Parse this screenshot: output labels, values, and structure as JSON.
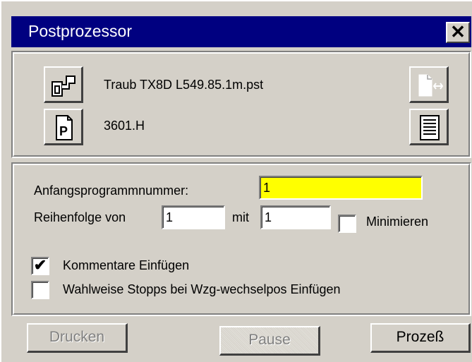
{
  "window": {
    "title": "Postprozessor",
    "close_label": "✕"
  },
  "files": {
    "machine_file": "Traub TX8D L549.85.1m.pst",
    "program_file": "3601.H"
  },
  "icons": {
    "machine": "machine-icon",
    "program": "program-p-icon",
    "file_transfer": "file-transfer-icon",
    "document": "document-list-icon"
  },
  "settings": {
    "start_label": "Anfangsprogrammnummer:",
    "start_value": "1",
    "order_label": "Reihenfolge von",
    "order_from": "1",
    "order_with_label": "mit",
    "order_with": "1",
    "minimize_label": "Minimieren",
    "minimize_checked": false,
    "comments_label": "Kommentare Einfügen",
    "comments_checked": true,
    "stops_label": "Wahlweise Stopps bei Wzg-wechselpos Einfügen",
    "stops_checked": false
  },
  "buttons": {
    "print": "Drucken",
    "pause": "Pause",
    "process": "Prozeß"
  },
  "colors": {
    "titlebar": "#000080",
    "highlight_field": "#ffff00",
    "face": "#d4d0c8"
  }
}
